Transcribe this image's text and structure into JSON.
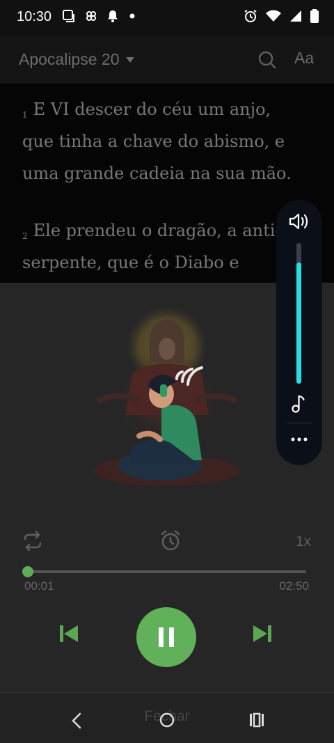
{
  "status_bar": {
    "time": "10:30"
  },
  "app_bar": {
    "chapter": "Apocalipse 20",
    "font_button": "Aa"
  },
  "reading": {
    "verses": [
      {
        "number": "1",
        "lines": [
          "E VI descer do céu um anjo,",
          "que tinha a chave do abismo, e",
          "uma grande cadeia na sua mão."
        ]
      },
      {
        "number": "2",
        "lines": [
          "Ele prendeu o dragão, a antiga",
          "serpente, que é o Diabo e"
        ]
      }
    ]
  },
  "player": {
    "speed": "1x",
    "current_time": "00:01",
    "total_time": "02:50",
    "progress_fraction": 0.006
  },
  "volume_panel": {
    "level_fraction": 0.86
  },
  "bottom_sheet": {
    "close_label": "Fechar"
  },
  "colors": {
    "accent_green": "#61b05a",
    "volume_cyan": "#22e0e4"
  }
}
